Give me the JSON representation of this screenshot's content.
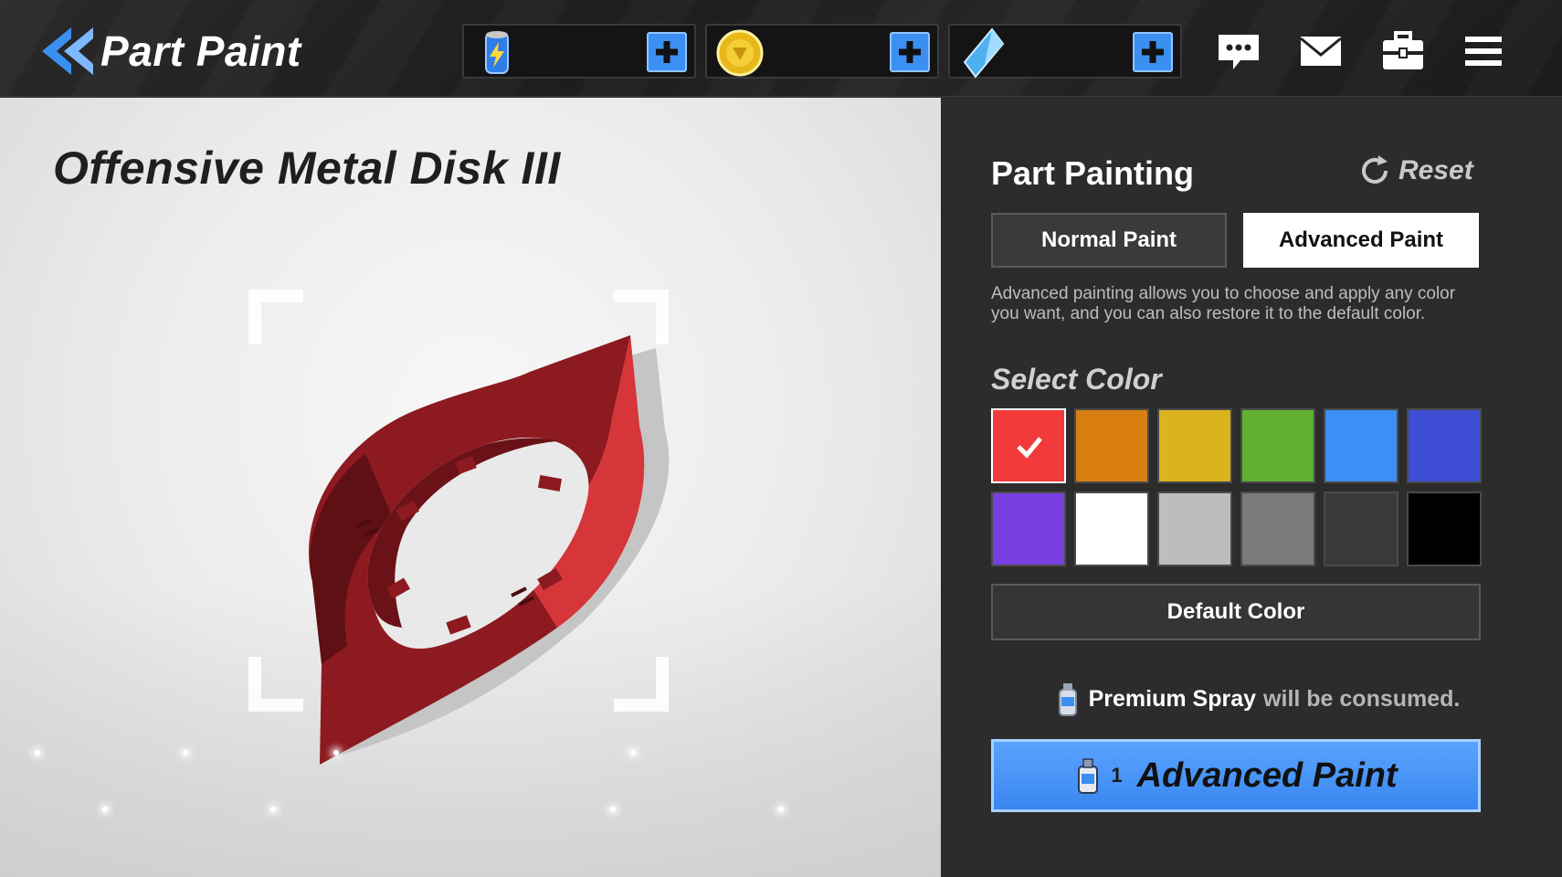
{
  "header": {
    "title": "Part Paint",
    "back_icon": "double-chevron-left-icon",
    "currencies": [
      {
        "name": "energy-can",
        "icon": "energy-can-icon",
        "value": ""
      },
      {
        "name": "gold-coin",
        "icon": "gold-coin-icon",
        "value": ""
      },
      {
        "name": "crystal",
        "icon": "blue-crystal-icon",
        "value": ""
      }
    ],
    "icons": [
      "chat-icon",
      "mail-icon",
      "toolbox-icon",
      "menu-icon"
    ]
  },
  "preview": {
    "part_name": "Offensive Metal Disk III",
    "part_color": "#b3282d"
  },
  "panel": {
    "title": "Part Painting",
    "reset_label": "Reset",
    "tabs": [
      {
        "label": "Normal Paint",
        "active": false
      },
      {
        "label": "Advanced Paint",
        "active": true
      }
    ],
    "description": "Advanced painting allows you to choose and apply any color you want, and you can also restore it to the default color.",
    "select_color_label": "Select Color",
    "swatches": [
      {
        "color": "#f23a3a",
        "selected": true
      },
      {
        "color": "#d97f12",
        "selected": false
      },
      {
        "color": "#d9b41e",
        "selected": false
      },
      {
        "color": "#62b02f",
        "selected": false
      },
      {
        "color": "#3b8ff5",
        "selected": false
      },
      {
        "color": "#3e4fd6",
        "selected": false
      },
      {
        "color": "#7a3fe0",
        "selected": false
      },
      {
        "color": "#ffffff",
        "selected": false
      },
      {
        "color": "#bdbdbd",
        "selected": false
      },
      {
        "color": "#7a7a7a",
        "selected": false
      },
      {
        "color": "#3a3a3a",
        "selected": false
      },
      {
        "color": "#000000",
        "selected": false
      }
    ],
    "default_color_label": "Default Color",
    "consume": {
      "item_name": "Premium Spray",
      "note": "will be consumed."
    },
    "apply": {
      "count": "1",
      "label": "Advanced Paint"
    }
  },
  "colors": {
    "accent": "#3b8ff0",
    "panel_bg": "#2c2c2c"
  }
}
